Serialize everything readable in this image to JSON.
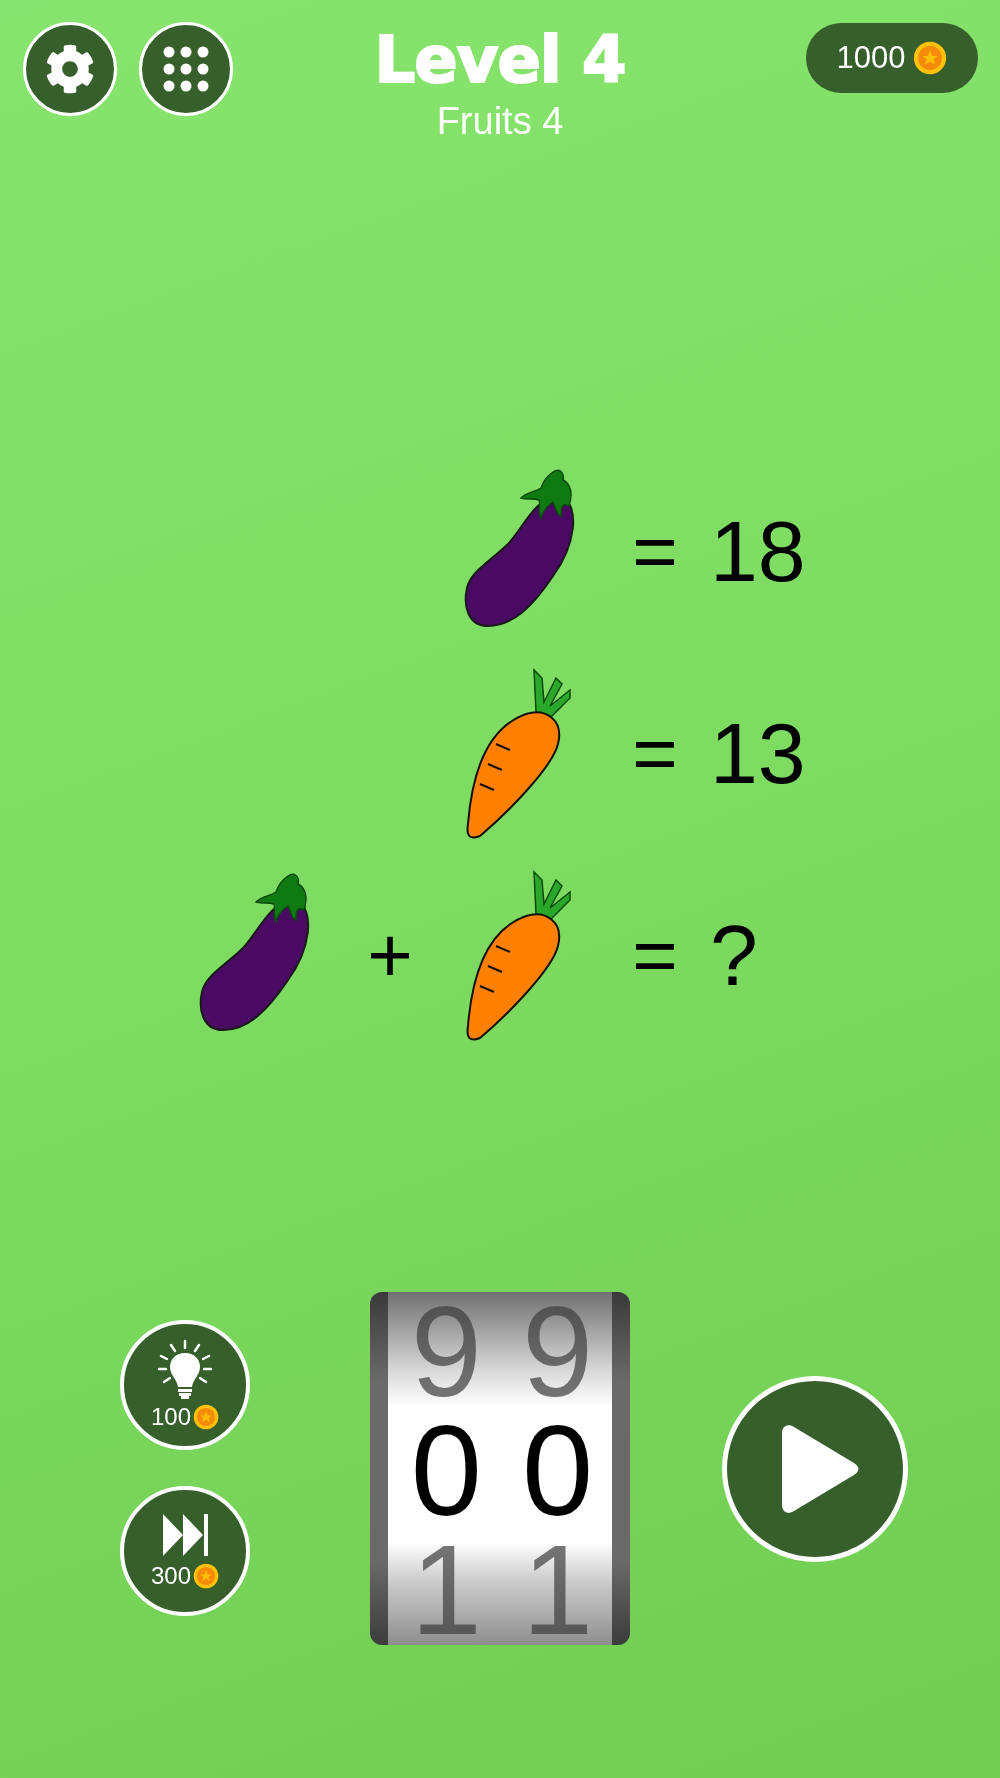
{
  "header": {
    "title": "Level 4",
    "subtitle": "Fruits 4",
    "coins": "1000"
  },
  "equations": [
    {
      "terms": [
        {
          "kind": "eggplant"
        }
      ],
      "equals": "=",
      "result": "18"
    },
    {
      "terms": [
        {
          "kind": "carrot"
        }
      ],
      "equals": "=",
      "result": "13"
    },
    {
      "terms": [
        {
          "kind": "eggplant"
        },
        {
          "kind": "operator",
          "text": "+"
        },
        {
          "kind": "carrot"
        }
      ],
      "equals": "=",
      "result": "?"
    }
  ],
  "powerups": [
    {
      "kind": "hint",
      "cost": "100"
    },
    {
      "kind": "skip",
      "cost": "300"
    }
  ],
  "counter": {
    "digits": [
      {
        "above": "9",
        "value": "0",
        "below": "1"
      },
      {
        "above": "9",
        "value": "0",
        "below": "1"
      }
    ]
  }
}
